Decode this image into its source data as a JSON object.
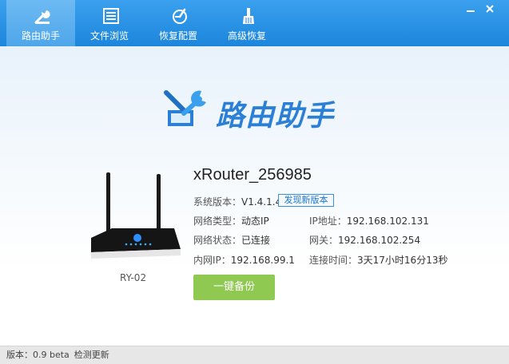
{
  "toolbar": {
    "tabs": [
      {
        "label": "路由助手",
        "icon": "wrench-icon"
      },
      {
        "label": "文件浏览",
        "icon": "document-list-icon"
      },
      {
        "label": "恢复配置",
        "icon": "restore-config-icon"
      },
      {
        "label": "高级恢复",
        "icon": "broom-icon"
      }
    ],
    "active_tab": 0,
    "window_buttons": [
      "minimize-icon",
      "close-icon"
    ]
  },
  "logo": {
    "title": "路由助手"
  },
  "device": {
    "name": "xRouter_256985",
    "model": "RY-02",
    "version_label": "系统版本：",
    "version": "V1.4.1.4",
    "new_version_badge": "发现新版本",
    "net_type_label": "网络类型：",
    "net_type": "动态IP",
    "ip_label": "IP地址：",
    "ip": "192.168.102.131",
    "net_status_label": "网络状态：",
    "net_status": "已连接",
    "gateway_label": "网关：",
    "gateway": "192.168.102.254",
    "lan_ip_label": "内网IP：",
    "lan_ip": "192.168.99.1",
    "uptime_label": "连接时间：",
    "uptime": "3天17小时16分13秒"
  },
  "actions": {
    "backup_button": "一键备份"
  },
  "status_bar": {
    "version_text": "版本：0.9 beta",
    "check_update": "检测更新"
  },
  "colors": {
    "toolbar": "#1d86dc",
    "accent": "#2b7fd4",
    "button_green": "#8fc951",
    "badge_border": "#3b8fe0"
  }
}
